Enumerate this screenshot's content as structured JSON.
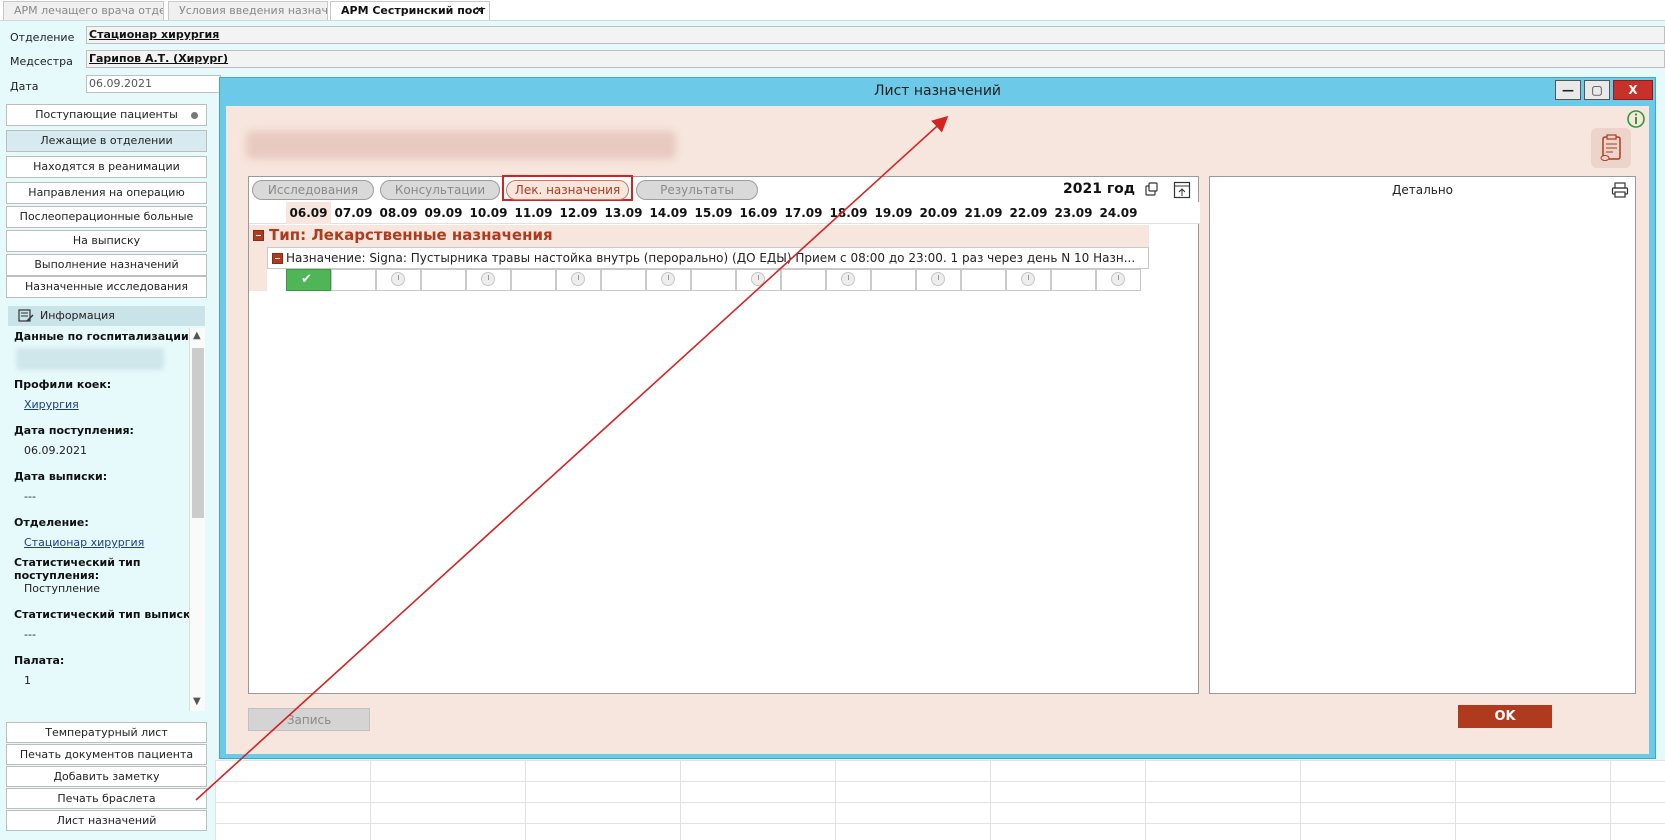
{
  "tabs": [
    {
      "label": "АРМ лечащего врача отде..."
    },
    {
      "label": "Условия введения назнач..."
    },
    {
      "label": "АРМ Сестринский пост",
      "close": "✕"
    }
  ],
  "header": {
    "department_label": "Отделение",
    "department_value": "Стационар  хирургия",
    "nurse_label": "Медсестра",
    "nurse_value": "Гарипов А.Т. (Хирург)",
    "date_label": "Дата",
    "date_value": "06.09.2021"
  },
  "nav": {
    "items": [
      {
        "label": "Поступающие пациенты"
      },
      {
        "label": "Лежащие в отделении"
      },
      {
        "label": "Находятся в реанимации"
      },
      {
        "label": "Направления на операцию"
      },
      {
        "label": "Послеоперационные больные"
      },
      {
        "label": "На выписку"
      },
      {
        "label": "Выполнение назначений"
      },
      {
        "label": "Назначенные исследования"
      }
    ]
  },
  "info": {
    "title": "Информация",
    "hosp_data_label": "Данные по госпитализации:",
    "bed_profiles_label": "Профили коек:",
    "bed_profiles_value": "Хирургия",
    "admission_date_label": "Дата поступления:",
    "admission_date_value": "06.09.2021",
    "discharge_date_label": "Дата выписки:",
    "discharge_date_value": "---",
    "department_label": "Отделение:",
    "department_value": "Стационар  хирургия",
    "stat_admission_label": "Статистический тип поступления:",
    "stat_admission_value": "Поступление",
    "stat_discharge_label": "Статистический тип выписки:",
    "stat_discharge_value": "---",
    "ward_label": "Палата:",
    "ward_value": "1"
  },
  "bottom_buttons": [
    {
      "label": "Температурный лист"
    },
    {
      "label": "Печать документов пациента"
    },
    {
      "label": "Добавить заметку"
    },
    {
      "label": "Печать браслета"
    },
    {
      "label": "Лист назначений"
    }
  ],
  "dialog": {
    "title": "Лист назначений",
    "minimize": "—",
    "maximize": "▢",
    "close": "X",
    "filters": [
      {
        "label": "Исследования"
      },
      {
        "label": "Консультации"
      },
      {
        "label": "Лек. назначения"
      },
      {
        "label": "Результаты"
      }
    ],
    "year": "2021 год",
    "dates": [
      "06.09",
      "07.09",
      "08.09",
      "09.09",
      "10.09",
      "11.09",
      "12.09",
      "13.09",
      "14.09",
      "15.09",
      "16.09",
      "17.09",
      "18.09",
      "19.09",
      "20.09",
      "21.09",
      "22.09",
      "23.09",
      "24.09"
    ],
    "type_title": "Тип: Лекарственные назначения",
    "appointment_text": "Назначение: Signa: Пустырника травы настойка  внутрь (перорально) (ДО ЕДЫ)   Прием с 08:00 до 23:00. 1 раз через день N 10 Назн...",
    "detail_title": "Детально",
    "save_label": "Запись",
    "ok_label": "OK"
  },
  "colors": {
    "accent": "#b03a1e",
    "dialog_frame": "#6ccae8",
    "highlight": "#d42323",
    "done": "#4fb556"
  }
}
